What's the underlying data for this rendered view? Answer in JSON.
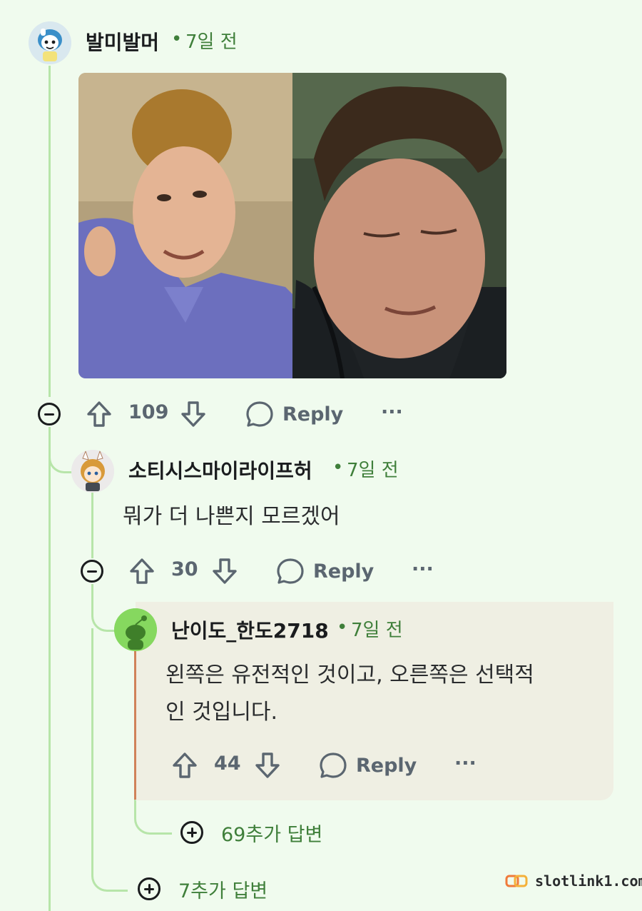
{
  "comments": [
    {
      "username": "발미발머",
      "separator": "•",
      "time": "7일 전",
      "votes": "109",
      "reply_label": "Reply",
      "more_label": "···"
    },
    {
      "username": "소티시스마이라이프허",
      "separator": "•",
      "time": "7일 전",
      "body": "뭐가 더 나쁜지 모르겠어",
      "votes": "30",
      "reply_label": "Reply",
      "more_label": "···"
    },
    {
      "username": "난이도_한도2718",
      "separator": "•",
      "time": "7일 전",
      "body_line1": "왼쪽은 유전적인 것이고, 오른쪽은 선택적",
      "body_line2": "인 것입니다.",
      "votes": "44",
      "reply_label": "Reply",
      "more_label": "···"
    }
  ],
  "more_replies": [
    {
      "label": "69추가 답변"
    },
    {
      "label": "7추가 답변"
    }
  ],
  "watermark": {
    "text": "slotlink1.com"
  },
  "colors": {
    "background": "#f0fbee",
    "thread_line": "#b7e5a9",
    "meta_green": "#3f7f3a",
    "highlight_bg": "#efefe3",
    "highlight_bar": "#d0825a"
  }
}
